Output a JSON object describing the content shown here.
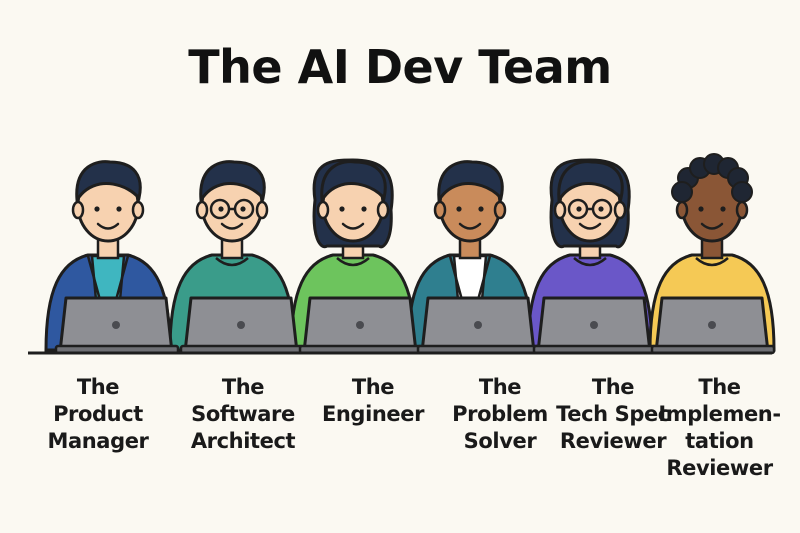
{
  "title": "The AI Dev Team",
  "colors": {
    "background": "#fbf9f2",
    "outline": "#1e1e1e",
    "laptop": "#8e8f94",
    "desk": "#1e1e1e"
  },
  "members": [
    {
      "label_lines": [
        "The",
        "Product",
        "Manager"
      ],
      "shirt_color": "#2f58a0",
      "undershirt_color": "#3fb6c0",
      "hair_color": "#23314a",
      "skin_color": "#f7d2b0",
      "glasses": false,
      "icon": "product-manager-avatar"
    },
    {
      "label_lines": [
        "The",
        "Software",
        "Architect"
      ],
      "shirt_color": "#3a9c8a",
      "undershirt_color": "#3a9c8a",
      "hair_color": "#23314a",
      "skin_color": "#f7d2b0",
      "glasses": true,
      "icon": "software-architect-avatar"
    },
    {
      "label_lines": [
        "The",
        "Engineer"
      ],
      "shirt_color": "#6dc45d",
      "undershirt_color": "#6dc45d",
      "hair_color": "#23314a",
      "skin_color": "#f7d2b0",
      "glasses": false,
      "icon": "engineer-avatar"
    },
    {
      "label_lines": [
        "The",
        "Problem",
        "Solver"
      ],
      "shirt_color": "#2f7f8f",
      "undershirt_color": "#ffffff",
      "hair_color": "#23314a",
      "skin_color": "#c98b5b",
      "glasses": false,
      "icon": "problem-solver-avatar"
    },
    {
      "label_lines": [
        "The",
        "Tech Spec",
        "Reviewer"
      ],
      "shirt_color": "#6a57c8",
      "undershirt_color": "#6a57c8",
      "hair_color": "#23314a",
      "skin_color": "#f7d2b0",
      "glasses": true,
      "icon": "tech-spec-reviewer-avatar"
    },
    {
      "label_lines": [
        "The",
        "Implemen-",
        "tation",
        "Reviewer"
      ],
      "shirt_color": "#f5c955",
      "undershirt_color": "#f5c955",
      "hair_color": "#1f2633",
      "skin_color": "#8a5636",
      "glasses": false,
      "icon": "implementation-reviewer-avatar"
    }
  ]
}
